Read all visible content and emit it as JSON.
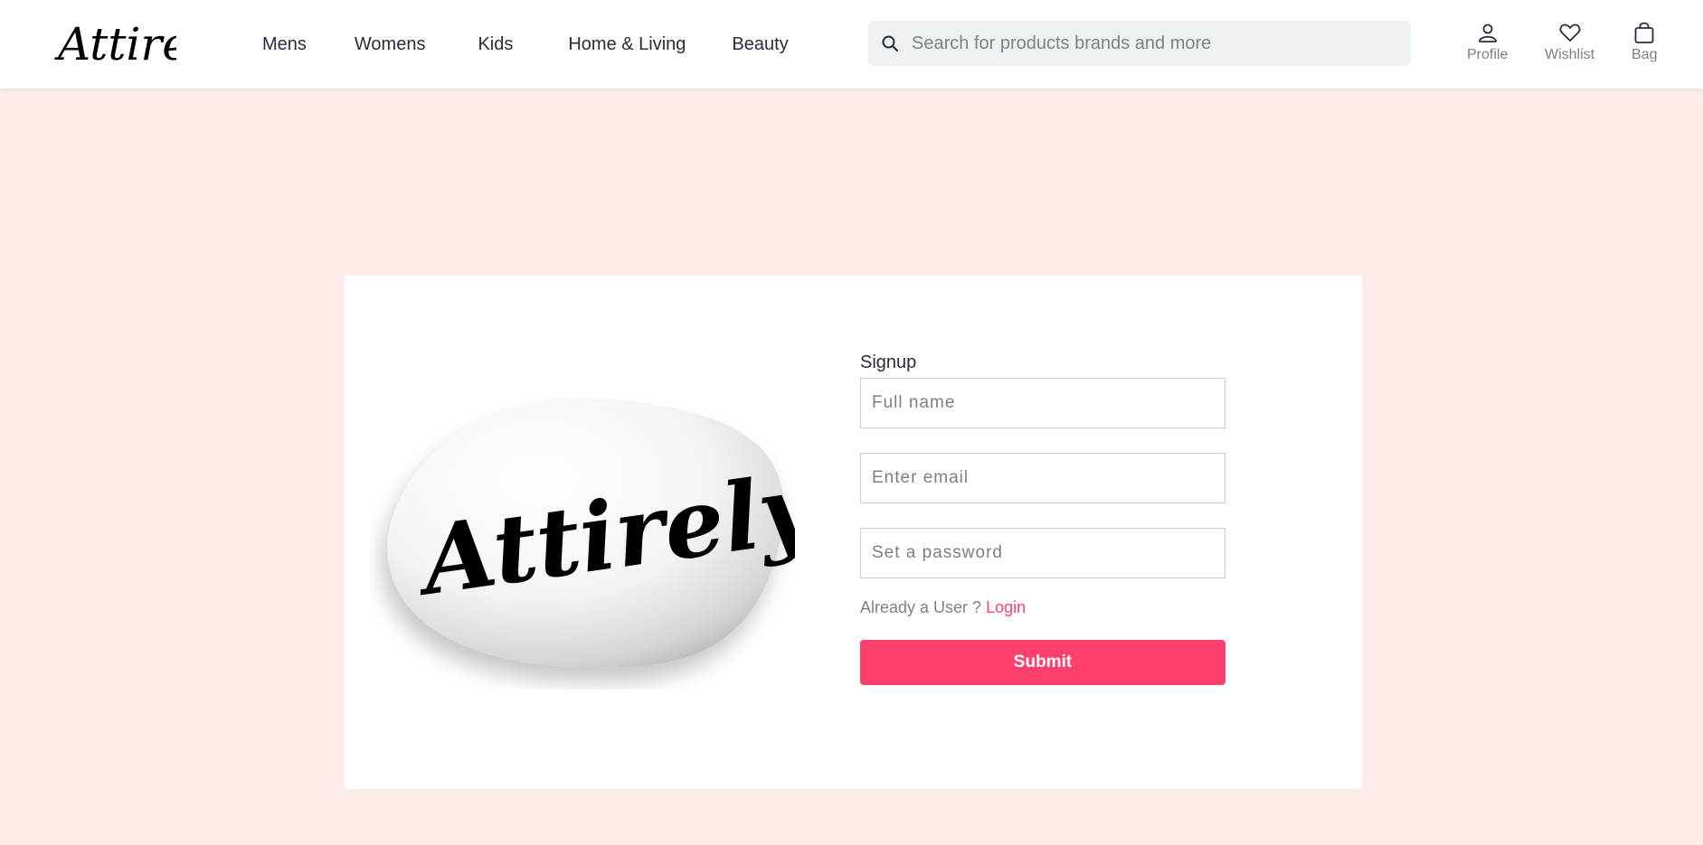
{
  "header": {
    "logo_text": "Attirely",
    "nav": [
      {
        "label": "Mens"
      },
      {
        "label": "Womens"
      },
      {
        "label": "Kids"
      },
      {
        "label": "Home & Living"
      },
      {
        "label": "Beauty"
      }
    ],
    "search": {
      "placeholder": "Search for products brands and more",
      "icon": "search-icon"
    },
    "actions": [
      {
        "label": "Profile",
        "icon": "user-icon"
      },
      {
        "label": "Wishlist",
        "icon": "heart-icon"
      },
      {
        "label": "Bag",
        "icon": "shopping-bag-icon"
      }
    ]
  },
  "hero": {
    "logo_text": "Attirely"
  },
  "signup": {
    "title": "Signup",
    "fields": {
      "full_name": {
        "placeholder": "Full name"
      },
      "email": {
        "placeholder": "Enter email"
      },
      "password": {
        "placeholder": "Set a password"
      }
    },
    "already_user_text": "Already a User ?",
    "login_link": "Login",
    "submit_label": "Submit"
  },
  "colors": {
    "accent": "#ff3f6c",
    "page_background": "#fdecea",
    "search_background": "#eef2f3"
  }
}
